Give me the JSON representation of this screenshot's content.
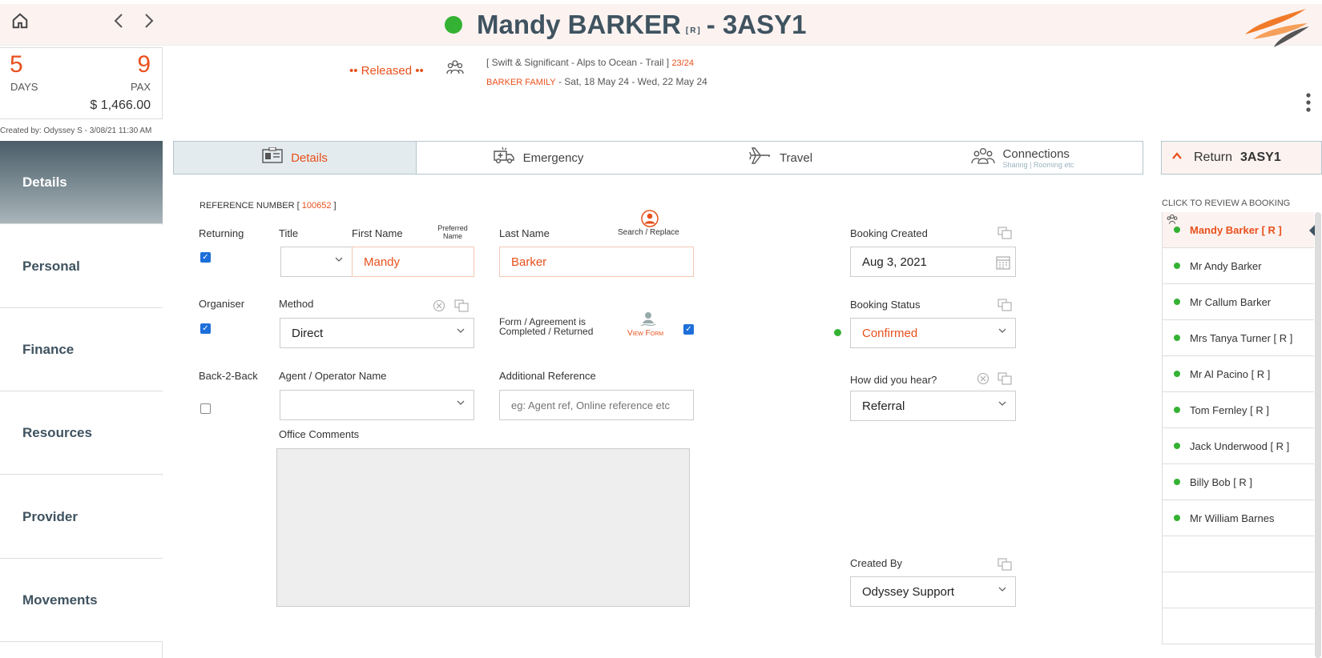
{
  "header": {
    "name": "Mandy BARKER",
    "returning_tag": "[R]",
    "code": "- 3ASY1",
    "status_color": "#34b233",
    "accent": "#e8501c"
  },
  "summary": {
    "days_value": "5",
    "days_label": "DAYS",
    "pax_value": "9",
    "pax_label": "PAX",
    "price": "$ 1,466.00",
    "created_by": "Created by: Odyssey S - 3/08/21 11:30 AM"
  },
  "trip": {
    "status": "•• Released ••",
    "name": "[ Swift & Significant - Alps to Ocean - Trail ]",
    "code": "23/24",
    "family": "BARKER FAMILY",
    "dates": "- Sat, 18 May 24 - Wed, 22 May 24"
  },
  "sidebar": {
    "items": [
      {
        "label": "Details"
      },
      {
        "label": "Personal"
      },
      {
        "label": "Finance"
      },
      {
        "label": "Resources"
      },
      {
        "label": "Provider"
      },
      {
        "label": "Movements"
      }
    ]
  },
  "tabs": {
    "details": "Details",
    "emergency": "Emergency",
    "travel": "Travel",
    "connections": "Connections",
    "connections_sub": "Sharing | Rooming etc"
  },
  "form": {
    "ref_label": "REFERENCE NUMBER [",
    "ref_value": "100652",
    "ref_close": "]",
    "returning_label": "Returning",
    "title_label": "Title",
    "first_name_label": "First Name",
    "preferred_name_label": "Preferred Name",
    "last_name_label": "Last Name",
    "search_replace_label": "Search / Replace",
    "first_name_value": "Mandy",
    "last_name_value": "Barker",
    "organiser_label": "Organiser",
    "method_label": "Method",
    "method_value": "Direct",
    "form_agreement_label_1": "Form / Agreement is",
    "form_agreement_label_2": "Completed / Returned",
    "view_form": "View Form",
    "back2back_label": "Back-2-Back",
    "agent_label": "Agent / Operator Name",
    "additional_ref_label": "Additional Reference",
    "additional_ref_placeholder": "eg: Agent ref, Online reference etc",
    "office_comments_label": "Office Comments",
    "booking_created_label": "Booking Created",
    "booking_created_value": "Aug 3, 2021",
    "booking_status_label": "Booking Status",
    "booking_status_value": "Confirmed",
    "how_hear_label": "How did you hear?",
    "how_hear_value": "Referral",
    "created_by_label": "Created By",
    "created_by_value": "Odyssey Support"
  },
  "right_panel": {
    "return_label": "Return",
    "return_code": "3ASY1",
    "click_review": "CLICK TO REVIEW A BOOKING",
    "people": [
      {
        "name": "Mandy Barker  [ R ]"
      },
      {
        "name": "Mr Andy Barker"
      },
      {
        "name": "Mr Callum Barker"
      },
      {
        "name": "Mrs Tanya Turner  [ R ]"
      },
      {
        "name": "Mr Al Pacino  [ R ]"
      },
      {
        "name": "Tom Fernley  [ R ]"
      },
      {
        "name": "Jack Underwood  [ R ]"
      },
      {
        "name": "Billy Bob  [ R ]"
      },
      {
        "name": "Mr William Barnes"
      }
    ]
  }
}
